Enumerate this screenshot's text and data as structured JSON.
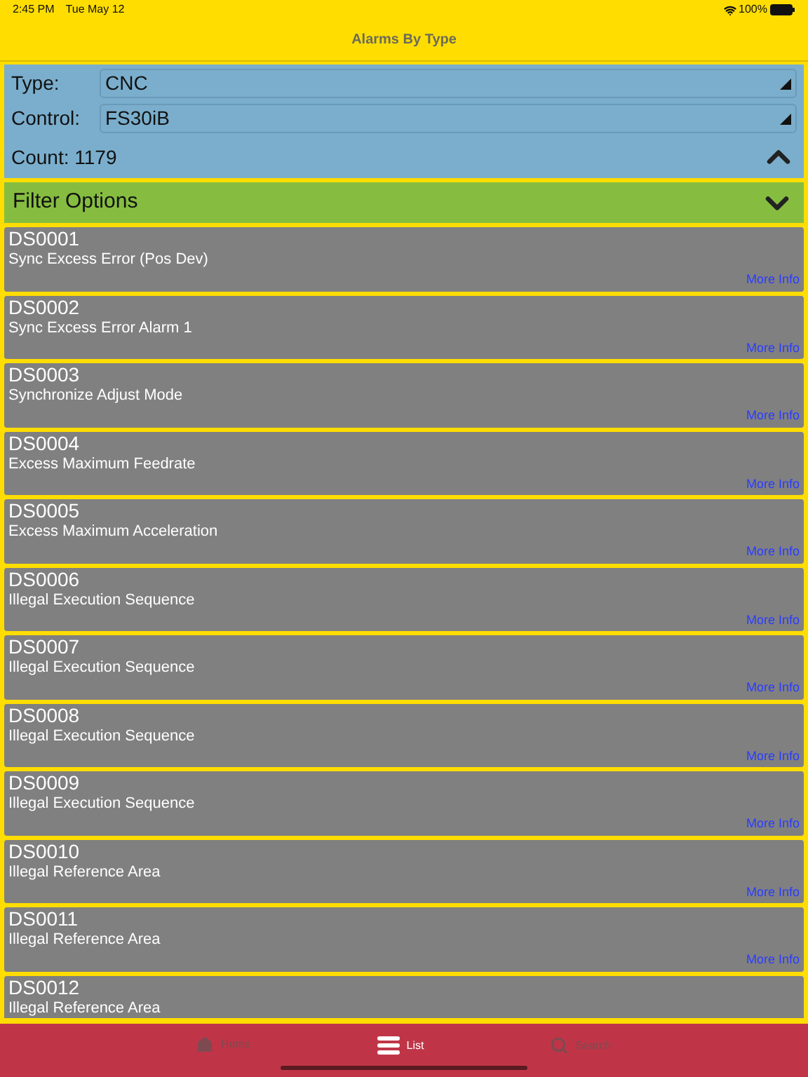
{
  "status_bar": {
    "time": "2:45 PM",
    "date": "Tue May 12",
    "battery": "100%"
  },
  "header": {
    "title": "Alarms By Type"
  },
  "filters": {
    "fields": [
      {
        "label": "Type:",
        "value": "CNC"
      },
      {
        "label": "Control:",
        "value": "FS30iB"
      }
    ],
    "count": "Count: 1179",
    "expanded": true
  },
  "filter_options": {
    "label": "Filter Options",
    "expanded": false
  },
  "alarms": [
    {
      "code": "DS0001",
      "description": "Sync Excess Error (Pos Dev)",
      "link": "More Info"
    },
    {
      "code": "DS0002",
      "description": "Sync Excess Error Alarm 1",
      "link": "More Info"
    },
    {
      "code": "DS0003",
      "description": "Synchronize Adjust Mode",
      "link": "More Info"
    },
    {
      "code": "DS0004",
      "description": "Excess Maximum Feedrate",
      "link": "More Info"
    },
    {
      "code": "DS0005",
      "description": "Excess Maximum Acceleration",
      "link": "More Info"
    },
    {
      "code": "DS0006",
      "description": "Illegal Execution Sequence",
      "link": "More Info"
    },
    {
      "code": "DS0007",
      "description": "Illegal Execution Sequence",
      "link": "More Info"
    },
    {
      "code": "DS0008",
      "description": "Illegal Execution Sequence",
      "link": "More Info"
    },
    {
      "code": "DS0009",
      "description": "Illegal Execution Sequence",
      "link": "More Info"
    },
    {
      "code": "DS0010",
      "description": "Illegal Reference Area",
      "link": "More Info"
    },
    {
      "code": "DS0011",
      "description": "Illegal Reference Area",
      "link": "More Info"
    },
    {
      "code": "DS0012",
      "description": "Illegal Reference Area"
    }
  ],
  "tab_bar": [
    {
      "kind": "home",
      "label": "Home",
      "selected": false
    },
    {
      "kind": "list",
      "label": "List",
      "selected": true
    },
    {
      "kind": "search",
      "label": "Search",
      "selected": false
    }
  ]
}
